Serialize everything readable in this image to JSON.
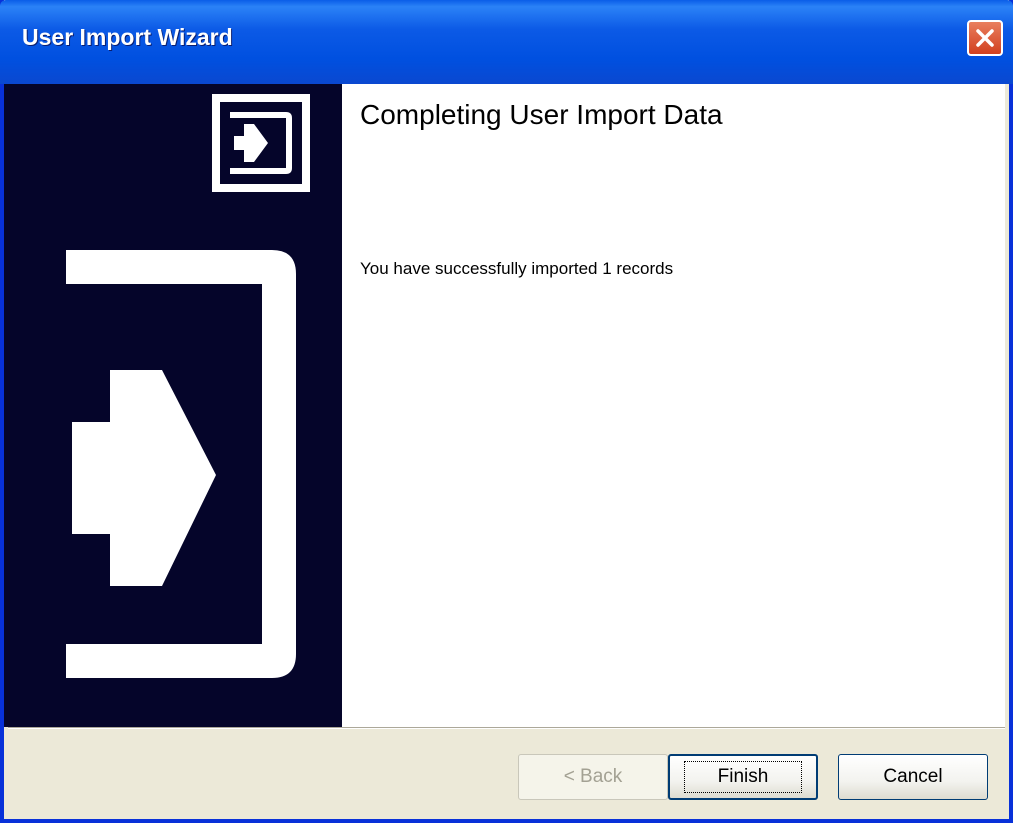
{
  "window": {
    "title": "User Import Wizard"
  },
  "page": {
    "heading": "Completing User Import Data",
    "message": "You have successfully imported 1 records"
  },
  "buttons": {
    "back": "< Back",
    "finish": "Finish",
    "cancel": "Cancel"
  },
  "icons": {
    "close": "close-icon",
    "import_small": "import-arrow-icon",
    "import_large": "import-arrow-icon"
  },
  "colors": {
    "titlebar": "#0050e0",
    "side_panel": "#05052a",
    "dialog_face": "#ece9d8"
  }
}
